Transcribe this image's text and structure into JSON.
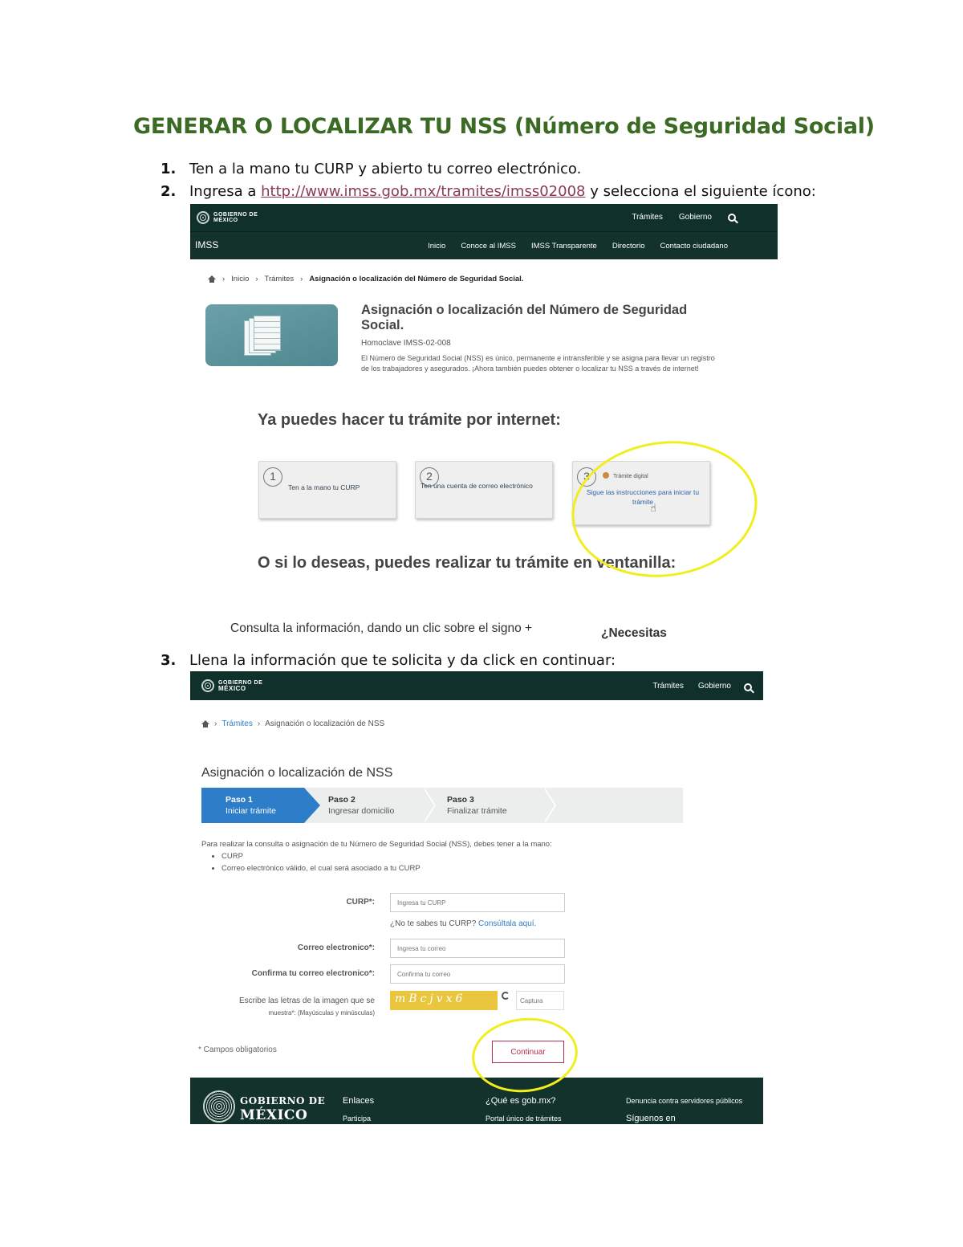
{
  "doc": {
    "title": "GENERAR O LOCALIZAR TU NSS (Número de Seguridad Social)",
    "steps": [
      {
        "num": "1.",
        "text": "Ten a la mano tu CURP y abierto tu correo electrónico."
      },
      {
        "num": "2.",
        "before": "Ingresa a ",
        "link": "http://www.imss.gob.mx/tramites/imss02008",
        "after": " y selecciona el siguiente ícono:"
      },
      {
        "num": "3.",
        "text": "Llena la información que te solicita y da click en continuar:"
      }
    ]
  },
  "shot1": {
    "gob_logo": [
      "GOBIERNO DE",
      "MÉXICO"
    ],
    "gob_nav": [
      "Trámites",
      "Gobierno"
    ],
    "brand": "IMSS",
    "imss_nav": [
      "Inicio",
      "Conoce al IMSS",
      "IMSS Transparente",
      "Directorio",
      "Contacto ciudadano"
    ],
    "breadcrumb": [
      "Inicio",
      "Trámites",
      "Asignación o localización del Número de Seguridad Social."
    ],
    "procedure_title": "Asignación o localización del Número de Seguridad Social.",
    "homoclave": "Homoclave IMSS-02-008",
    "description": "El Número de Seguridad Social (NSS) es único, permanente e intransferible y se asigna para llevar un registro de los trabajadores y asegurados. ¡Ahora también puedes obtener o localizar tu NSS a través de internet!",
    "online_heading": "Ya puedes hacer tu trámite por internet:",
    "cards": [
      {
        "num": "1",
        "text": "Ten a la mano tu CURP"
      },
      {
        "num": "2",
        "text": "Ten una cuenta de correo electrónico"
      },
      {
        "num": "3",
        "lead": "Trámite digital",
        "text": "Sigue las instrucciones para iniciar tu trámite"
      }
    ],
    "window_heading": "O si lo deseas, puedes realizar tu trámite en ventanilla:",
    "consult_text": "Consulta la información, dando un clic sobre el signo +",
    "need_text": "¿Necesitas"
  },
  "shot2": {
    "gob_logo": [
      "GOBIERNO DE",
      "MÉXICO"
    ],
    "gob_nav": [
      "Trámites",
      "Gobierno"
    ],
    "breadcrumb": [
      "Trámites",
      "Asignación o localización de NSS"
    ],
    "heading": "Asignación o localización de NSS",
    "stepper": [
      {
        "label": "Paso 1",
        "sub": "Iniciar trámite"
      },
      {
        "label": "Paso 2",
        "sub": "Ingresar domicilio"
      },
      {
        "label": "Paso 3",
        "sub": "Finalizar trámite"
      }
    ],
    "intro": "Para realizar la consulta o asignación de tu Número de Seguridad Social (NSS), debes tener a la mano:",
    "requirements": [
      "CURP",
      "Correo electrónico válido, el cual será asociado a tu CURP"
    ],
    "curp_label": "CURP*:",
    "curp_placeholder": "Ingresa tu CURP",
    "curp_help": "¿No te sabes tu CURP? ",
    "curp_link": "Consúltala aquí.",
    "email_label": "Correo electronico*:",
    "email_placeholder": "Ingresa tu correo",
    "confirm_label": "Confirma tu correo electronico*:",
    "confirm_placeholder": "Confirma tu correo",
    "captcha_label_1": "Escribe las letras de la imagen que se",
    "captcha_label_2": "muestra*: (Mayúsculas y minúsculas)",
    "captcha_text": "mBcjvx6",
    "captcha_placeholder": "Captura",
    "required_note": "* Campos obligatorios",
    "continue_label": "Continuar",
    "footer": {
      "logo_1": "GOBIERNO DE",
      "logo_2": "MÉXICO",
      "col1": [
        "Enlaces",
        "Participa"
      ],
      "col2": [
        "¿Qué es gob.mx?",
        "Portal único de trámites"
      ],
      "col3": [
        "Denuncia contra servidores públicos",
        "Síguenos en"
      ]
    }
  },
  "colors": {
    "title_green": "#3a6a24",
    "gob_green": "#10312b",
    "highlight_yellow": "#f1ee1e",
    "step_blue": "#2e7dc8",
    "button_red": "#b5304d"
  }
}
